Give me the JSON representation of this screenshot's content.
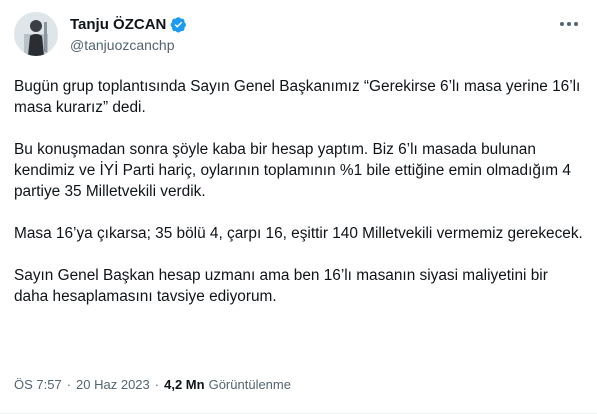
{
  "author": {
    "display_name": "Tanju ÖZCAN",
    "handle": "@tanjuozcanchp",
    "verified": true,
    "verified_color": "#1d9bf0",
    "avatar_icon": "profile-photo"
  },
  "tweet": {
    "paragraphs": [
      "Bugün grup toplantısında Sayın Genel Başkanımız “Gerekirse 6’lı masa yerine 16’lı masa kurarız” dedi.",
      "Bu konuşmadan sonra şöyle kaba bir hesap yaptım. Biz 6’lı masada bulunan kendimiz ve İYİ Parti hariç, oylarının toplamının %1 bile ettiğine emin olmadığım 4 partiye 35 Milletvekili verdik.",
      "Masa 16’ya çıkarsa; 35 bölü 4, çarpı 16, eşittir 140 Milletvekili vermemiz gerekecek.",
      "Sayın Genel Başkan hesap uzmanı ama ben 16’lı masanın siyasi maliyetini bir daha hesaplamasını tavsiye ediyorum."
    ],
    "time": "ÖS 7:57",
    "separator": "·",
    "date": "20 Haz 2023",
    "views_count": "4,2 Mn",
    "views_label": "Görüntülenme"
  }
}
